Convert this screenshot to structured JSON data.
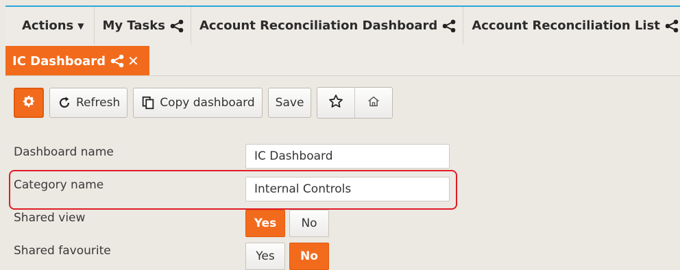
{
  "tabs": {
    "actions_label": "Actions",
    "items": [
      {
        "label": "My Tasks"
      },
      {
        "label": "Account Reconciliation Dashboard"
      },
      {
        "label": "Account Reconciliation List"
      }
    ],
    "active_tab": {
      "label": "IC Dashboard"
    }
  },
  "toolbar": {
    "refresh_label": "Refresh",
    "copy_label": "Copy dashboard",
    "save_label": "Save"
  },
  "form": {
    "dashboard_name_label": "Dashboard name",
    "dashboard_name_value": "IC Dashboard",
    "category_name_label": "Category name",
    "category_name_value": "Internal Controls",
    "shared_view_label": "Shared view",
    "shared_view_yes": "Yes",
    "shared_view_no": "No",
    "shared_view_selected": "Yes",
    "shared_favourite_label": "Shared favourite",
    "shared_favourite_yes": "Yes",
    "shared_favourite_no": "No",
    "shared_favourite_selected": "No"
  },
  "icons": {
    "share": "share-icon",
    "close": "close-icon",
    "gear": "gear-icon",
    "refresh": "refresh-icon",
    "copy": "copy-icon",
    "star": "star-icon",
    "home": "home-icon"
  },
  "colors": {
    "accent": "#f26b1d",
    "top_line": "#29a7d8",
    "highlight": "#e01b24",
    "background": "#ece8e2"
  }
}
